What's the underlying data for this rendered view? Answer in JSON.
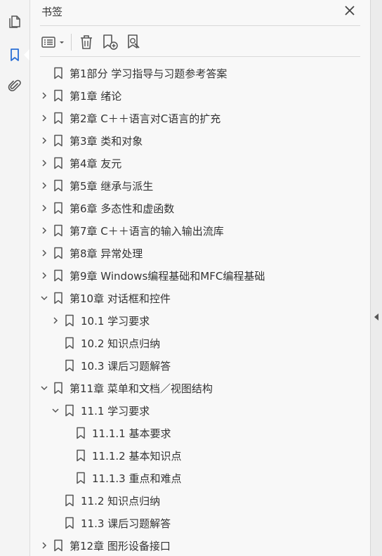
{
  "panel": {
    "title": "书签"
  },
  "colors": {
    "rail_active": "#2a6fd6",
    "icon": "#555555",
    "text": "#333333"
  },
  "icons": {
    "rail": [
      "page-thumbnails-icon",
      "bookmarks-icon",
      "attachments-icon"
    ],
    "toolbar": [
      "options-icon",
      "delete-bookmark-icon",
      "new-bookmark-icon",
      "find-bookmark-icon"
    ]
  },
  "bookmarks": [
    {
      "label": "第1部分  学习指导与习题参考答案",
      "level": 0,
      "expander": "none"
    },
    {
      "label": "第1章 绪论",
      "level": 0,
      "expander": "collapsed"
    },
    {
      "label": "第2章 C＋＋语言对C语言的扩充",
      "level": 0,
      "expander": "collapsed"
    },
    {
      "label": "第3章 类和对象",
      "level": 0,
      "expander": "collapsed"
    },
    {
      "label": "第4章 友元",
      "level": 0,
      "expander": "collapsed"
    },
    {
      "label": "第5章 继承与派生",
      "level": 0,
      "expander": "collapsed"
    },
    {
      "label": "第6章 多态性和虚函数",
      "level": 0,
      "expander": "collapsed"
    },
    {
      "label": "第7章 C＋＋语言的输入输出流库",
      "level": 0,
      "expander": "collapsed"
    },
    {
      "label": "第8章 异常处理",
      "level": 0,
      "expander": "collapsed"
    },
    {
      "label": "第9章 Windows编程基础和MFC编程基础",
      "level": 0,
      "expander": "collapsed"
    },
    {
      "label": "第10章 对话框和控件",
      "level": 0,
      "expander": "expanded"
    },
    {
      "label": "10.1 学习要求",
      "level": 1,
      "expander": "collapsed"
    },
    {
      "label": "10.2 知识点归纳",
      "level": 1,
      "expander": "none"
    },
    {
      "label": "10.3 课后习题解答",
      "level": 1,
      "expander": "none"
    },
    {
      "label": "第11章 菜单和文档／视图结构",
      "level": 0,
      "expander": "expanded"
    },
    {
      "label": "11.1 学习要求",
      "level": 1,
      "expander": "expanded"
    },
    {
      "label": "11.1.1 基本要求",
      "level": 2,
      "expander": "none"
    },
    {
      "label": "11.1.2 基本知识点",
      "level": 2,
      "expander": "none"
    },
    {
      "label": "11.1.3 重点和难点",
      "level": 2,
      "expander": "none"
    },
    {
      "label": "11.2 知识点归纳",
      "level": 1,
      "expander": "none"
    },
    {
      "label": "11.3 课后习题解答",
      "level": 1,
      "expander": "none"
    },
    {
      "label": "第12章 图形设备接口",
      "level": 0,
      "expander": "collapsed"
    }
  ]
}
